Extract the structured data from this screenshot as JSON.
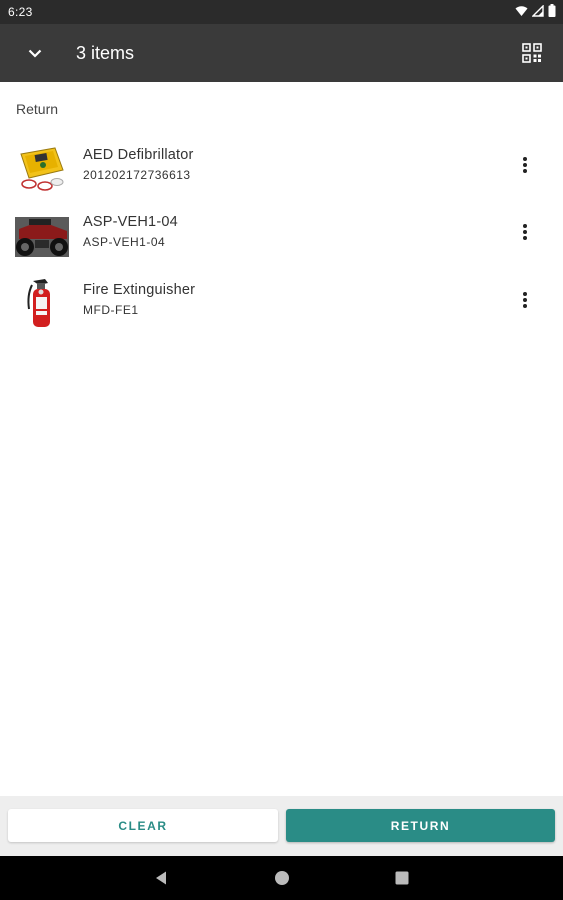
{
  "status_bar": {
    "time": "6:23",
    "icons": [
      "wifi-icon",
      "signal-icon",
      "battery-icon"
    ]
  },
  "app_bar": {
    "title": "3 items",
    "collapse_icon": "chevron-down-icon",
    "scan_icon": "qr-code-icon"
  },
  "section": {
    "label": "Return"
  },
  "items": [
    {
      "title": "AED Defibrillator",
      "subtitle": "201202172736613",
      "thumbnail": "aed-defibrillator-image"
    },
    {
      "title": "ASP-VEH1-04",
      "subtitle": "ASP-VEH1-04",
      "thumbnail": "atv-vehicle-image"
    },
    {
      "title": "Fire Extinguisher",
      "subtitle": "MFD-FE1",
      "thumbnail": "fire-extinguisher-image"
    }
  ],
  "actions": {
    "clear_label": "CLEAR",
    "return_label": "RETURN"
  },
  "colors": {
    "app_bar": "#3a3a3a",
    "status_bar": "#2b2b2b",
    "accent": "#2a8c86",
    "bottom_bar": "#eeeeee"
  },
  "nav_bar": {
    "icons": [
      "back-icon",
      "home-icon",
      "recents-icon"
    ]
  }
}
